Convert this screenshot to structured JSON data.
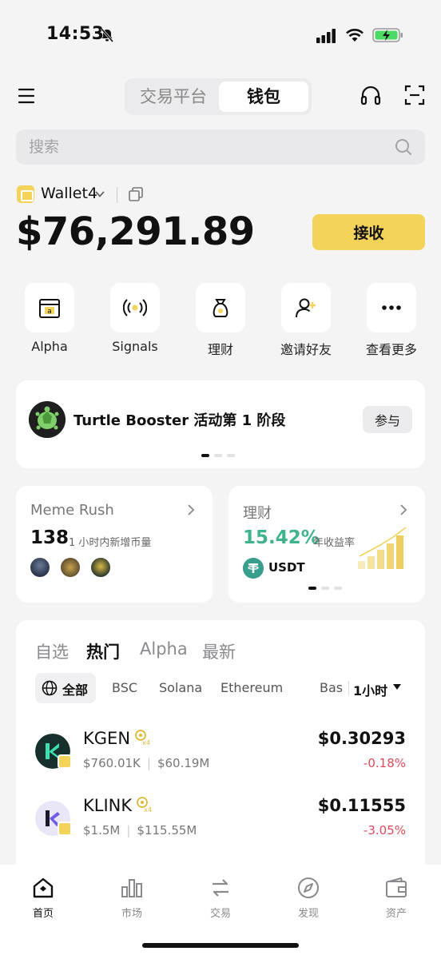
{
  "status_bar": {
    "time": "14:53"
  },
  "header": {
    "menu_icon": "menu-icon",
    "segments": [
      "交易平台",
      "钱包"
    ],
    "active_segment": "钱包"
  },
  "search": {
    "placeholder": "搜索"
  },
  "wallet": {
    "name": "Wallet4",
    "balance": "$76,291.89",
    "receive_label": "接收"
  },
  "quick_actions": [
    {
      "label": "Alpha",
      "icon": "alpha-icon"
    },
    {
      "label": "Signals",
      "icon": "signals-icon"
    },
    {
      "label": "理财",
      "icon": "money-bag-icon"
    },
    {
      "label": "邀请好友",
      "icon": "invite-friend-icon"
    },
    {
      "label": "查看更多",
      "icon": "more-icon"
    }
  ],
  "banner": {
    "title": "Turtle Booster 活动第 1 阶段",
    "join_label": "参与"
  },
  "meme_card": {
    "title": "Meme Rush",
    "count": "138",
    "subtitle": "1 小时内新增币量"
  },
  "earn_card": {
    "title": "理财",
    "apy": "15.42%",
    "apy_label": "年收益率",
    "asset": "USDT"
  },
  "market": {
    "tabs": [
      "自选",
      "热门",
      "Alpha",
      "最新"
    ],
    "active_tab": "热门",
    "chains": [
      "全部",
      "BSC",
      "Solana",
      "Ethereum",
      "Base"
    ],
    "active_chain": "全部",
    "timeframe": "1小时",
    "rows": [
      {
        "symbol": "KGEN",
        "volume": "$760.01K",
        "market_cap": "$60.19M",
        "price": "$0.30293",
        "change": "-0.18%"
      },
      {
        "symbol": "KLINK",
        "volume": "$1.5M",
        "market_cap": "$115.55M",
        "price": "$0.11555",
        "change": "-3.05%"
      }
    ]
  },
  "bottom_nav": [
    {
      "label": "首页",
      "icon": "home-icon",
      "active": true
    },
    {
      "label": "市场",
      "icon": "market-chart-icon",
      "active": false
    },
    {
      "label": "交易",
      "icon": "trade-swap-icon",
      "active": false
    },
    {
      "label": "发现",
      "icon": "discover-compass-icon",
      "active": false
    },
    {
      "label": "资产",
      "icon": "assets-wallet-icon",
      "active": false
    }
  ],
  "colors": {
    "accent_yellow": "#f3d35a",
    "positive_green": "#3fb38a",
    "negative_red": "#e24a5b",
    "background": "#f4f4f5"
  }
}
